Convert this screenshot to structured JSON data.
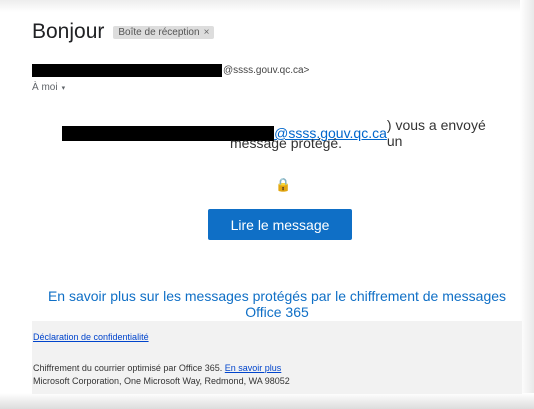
{
  "header": {
    "subject": "Bonjour",
    "label_chip": "Boîte de réception",
    "label_close": "×"
  },
  "sender": {
    "domain_suffix": "@ssss.gouv.qc.ca>",
    "to_label": "À moi",
    "to_caret": "▾"
  },
  "message": {
    "email_link": "@ssss.gouv.qc.ca",
    "line1_rest": ") vous a envoyé un",
    "line2": "message protégé.",
    "lock_icon": "🔒",
    "read_button": "Lire le message",
    "learn_more_line1": "En savoir plus sur les messages protégés par le chiffrement de messages",
    "learn_more_line2": "Office 365"
  },
  "footer": {
    "privacy_link": "Déclaration de confidentialité",
    "encryption_text": "Chiffrement du courrier optimisé par Office 365.",
    "encryption_link": "En savoir plus",
    "address": "Microsoft Corporation, One Microsoft Way, Redmond, WA 98052"
  },
  "colors": {
    "button": "#0f6fc6",
    "link": "#0066cc",
    "footer_bg": "#f2f2f2"
  }
}
